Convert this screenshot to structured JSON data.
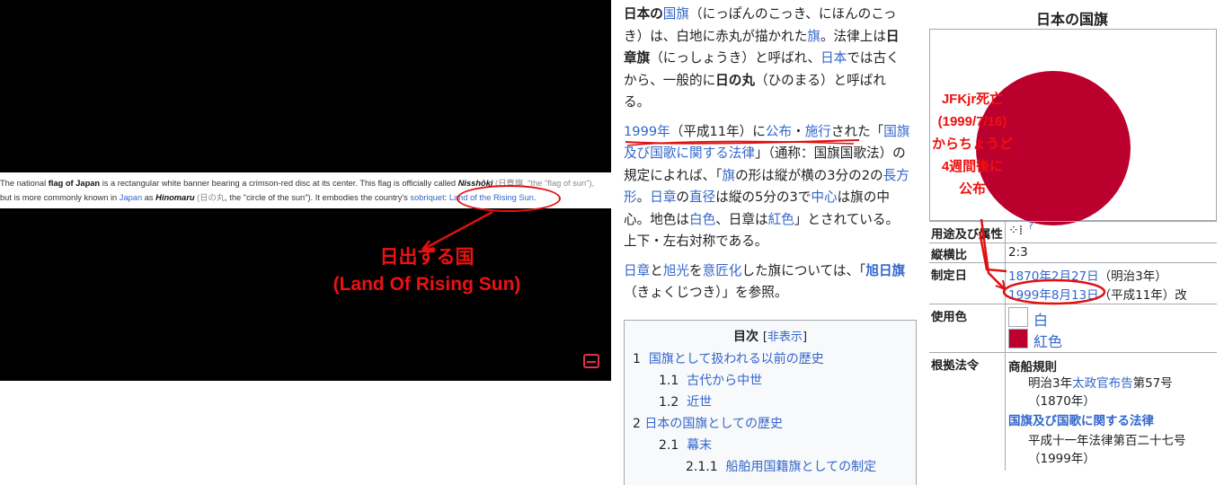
{
  "left": {
    "strip_line1_pre": "The national ",
    "strip_bold1": "flag of Japan",
    "strip_line1_mid": " is a rectangular white banner bearing a crimson-red disc at its center. This flag is officially called ",
    "strip_bold2": "Nisshōki",
    "strip_line1_faded": " (日章旗, \"the \"flag of sun\"),",
    "strip_line2_pre": "but is more commonly known in ",
    "strip_link_japan": "Japan",
    "strip_line2_as": " as ",
    "strip_bold3": "Hinomaru",
    "strip_line2_faded": " (日の丸",
    "strip_line2_mid": ", the \"circle of the sun\"). It embodies the country's ",
    "strip_link_sobriquet": "sobriquet",
    "strip_link_rising": "Land of the Rising Sun",
    "strip_end": ".",
    "annotation_jp": "日出ずる国",
    "annotation_en": "(Land Of Rising Sun)"
  },
  "article": {
    "p1": {
      "b1": "日本の",
      "a1": "国旗",
      "t1": "（にっぽんのこっき、にほんのこっき）は、白地に赤丸が描かれた",
      "a2": "旗",
      "t2": "。法律上は",
      "b2": "日章旗",
      "t3": "（にっしょうき）と呼ばれ、",
      "a3": "日本",
      "t4": "では古くから、一般的に",
      "b3": "日の丸",
      "t5": "（ひのまる）と呼ばれる。"
    },
    "p2": {
      "a1": "1999年",
      "t1": "（平成11年）に",
      "a2": "公布",
      "t2": "・",
      "a3": "施行",
      "t3": "された「",
      "a4": "国旗及び国歌に関する法律",
      "t4": "」（通称：国旗国歌法）の規定によれば、「",
      "a5": "旗",
      "t5": "の形は縦が横の3分の2の",
      "a6": "長方形",
      "t6": "。",
      "a7": "日章",
      "t7": "の",
      "a8": "直径",
      "t8": "は縦の5分の3で",
      "a9": "中心",
      "t9": "は旗の中心。地色は",
      "a10": "白色",
      "t10": "、日章は",
      "a11": "紅色",
      "t11": "」とされている。上下・左右対称である。"
    },
    "p3": {
      "a1": "日章",
      "t1": "と",
      "a2": "旭光",
      "t2": "を",
      "a3": "意匠化",
      "t3": "した旗については、「",
      "a4": "旭日旗",
      "t4": "（きょくじつき）」を参照。"
    }
  },
  "toc": {
    "title": "目次",
    "toggle_open": "[",
    "toggle": "非表示",
    "toggle_close": "]",
    "items": [
      {
        "num": "1",
        "label": "国旗として扱われる以前の歴史"
      },
      {
        "num": "1.1",
        "label": "古代から中世"
      },
      {
        "num": "1.2",
        "label": "近世"
      },
      {
        "num": "2",
        "label": "日本の国旗としての歴史"
      },
      {
        "num": "2.1",
        "label": "幕末"
      },
      {
        "num": "2.1.1",
        "label": "船舶用国籍旗としての制定"
      }
    ]
  },
  "infobox": {
    "title": "日本の国旗",
    "rows": {
      "usage_label": "用途及び属性",
      "usage_symbol": "⁘⁞",
      "usage_q": "?",
      "ratio_label": "縦横比",
      "ratio_value": "2:3",
      "date_label": "制定日",
      "date1": "1870年2月27日",
      "date1_note": "（明治3年）",
      "date2": "1999年8月13日",
      "date2_note": "（平成11年）改",
      "colors_label": "使用色",
      "color_white": "白",
      "color_red": "紅色",
      "law_label": "根拠法令",
      "law1_title": "商船規則",
      "law1_line1_pre": "明治3年",
      "law1_link": "太政官布告",
      "law1_line1_post": "第57号",
      "law1_line2": "（1870年）",
      "law2_title": "国旗及び国歌に関する法律",
      "law2_line1": "平成十一年法律第百二十七号",
      "law2_line2": "（1999年）"
    },
    "note": [
      "JFKjr死亡",
      "(1999/7/16)",
      "からちょうど",
      "4週間後に",
      "公布"
    ]
  },
  "colors": {
    "flag_red": "#bc002d",
    "annotation_red": "#ee1111",
    "link_blue": "#3366cc"
  }
}
